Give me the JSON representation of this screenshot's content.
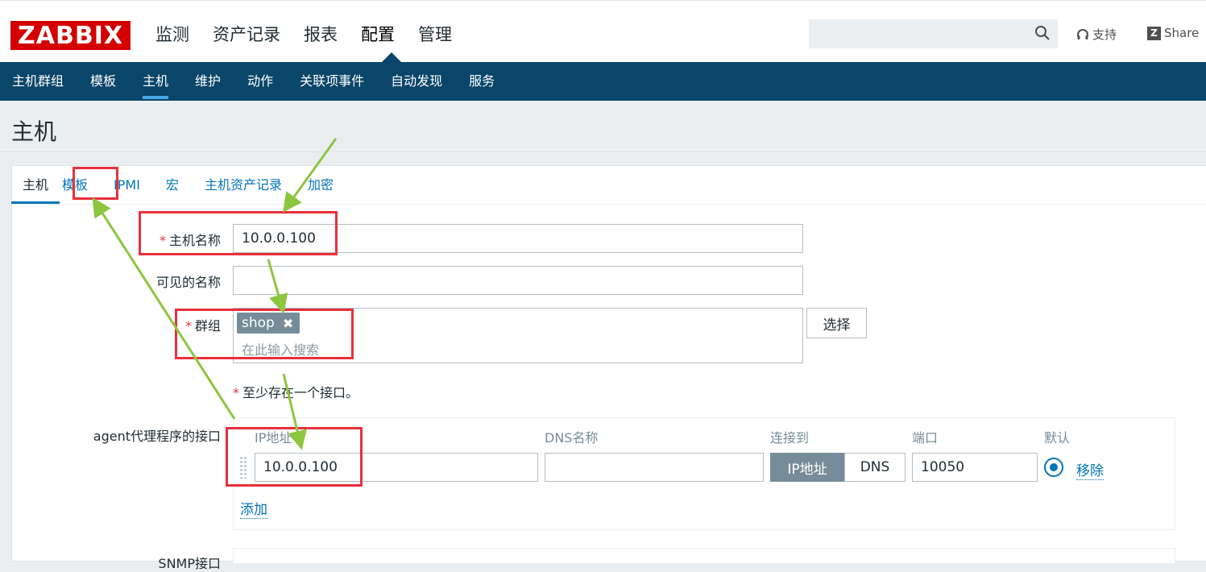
{
  "header": {
    "logo": "ZABBIX",
    "nav": [
      "监测",
      "资产记录",
      "报表",
      "配置",
      "管理"
    ],
    "support": "支持",
    "share": "Share",
    "share_badge": "Z"
  },
  "subnav": [
    "主机群组",
    "模板",
    "主机",
    "维护",
    "动作",
    "关联项事件",
    "自动发现",
    "服务"
  ],
  "page": {
    "title": "主机"
  },
  "tabs": [
    "主机",
    "模板",
    "IPMI",
    "宏",
    "主机资产记录",
    "加密"
  ],
  "form": {
    "required_mark": "*",
    "host_name_label": "主机名称",
    "host_name_value": "10.0.0.100",
    "visible_name_label": "可见的名称",
    "visible_name_value": "",
    "groups_label": "群组",
    "group_tag": "shop",
    "groups_placeholder": "在此输入搜索",
    "select_button": "选择",
    "interface_hint": "至少存在一个接口。",
    "agent_label": "agent代理程序的接口",
    "snmp_label": "SNMP接口"
  },
  "interface": {
    "headers": {
      "ip": "IP地址",
      "dns": "DNS名称",
      "connect": "连接到",
      "port": "端口",
      "default": "默认"
    },
    "ip_value": "10.0.0.100",
    "dns_value": "",
    "connect_ip": "IP地址",
    "connect_dns": "DNS",
    "port_value": "10050",
    "remove": "移除",
    "add": "添加"
  },
  "colors": {
    "accent": "#0275b8",
    "navbar": "#0a466a",
    "logo": "#d40000",
    "annotation_box": "#e8303b",
    "annotation_arrow": "#8cc63f"
  }
}
